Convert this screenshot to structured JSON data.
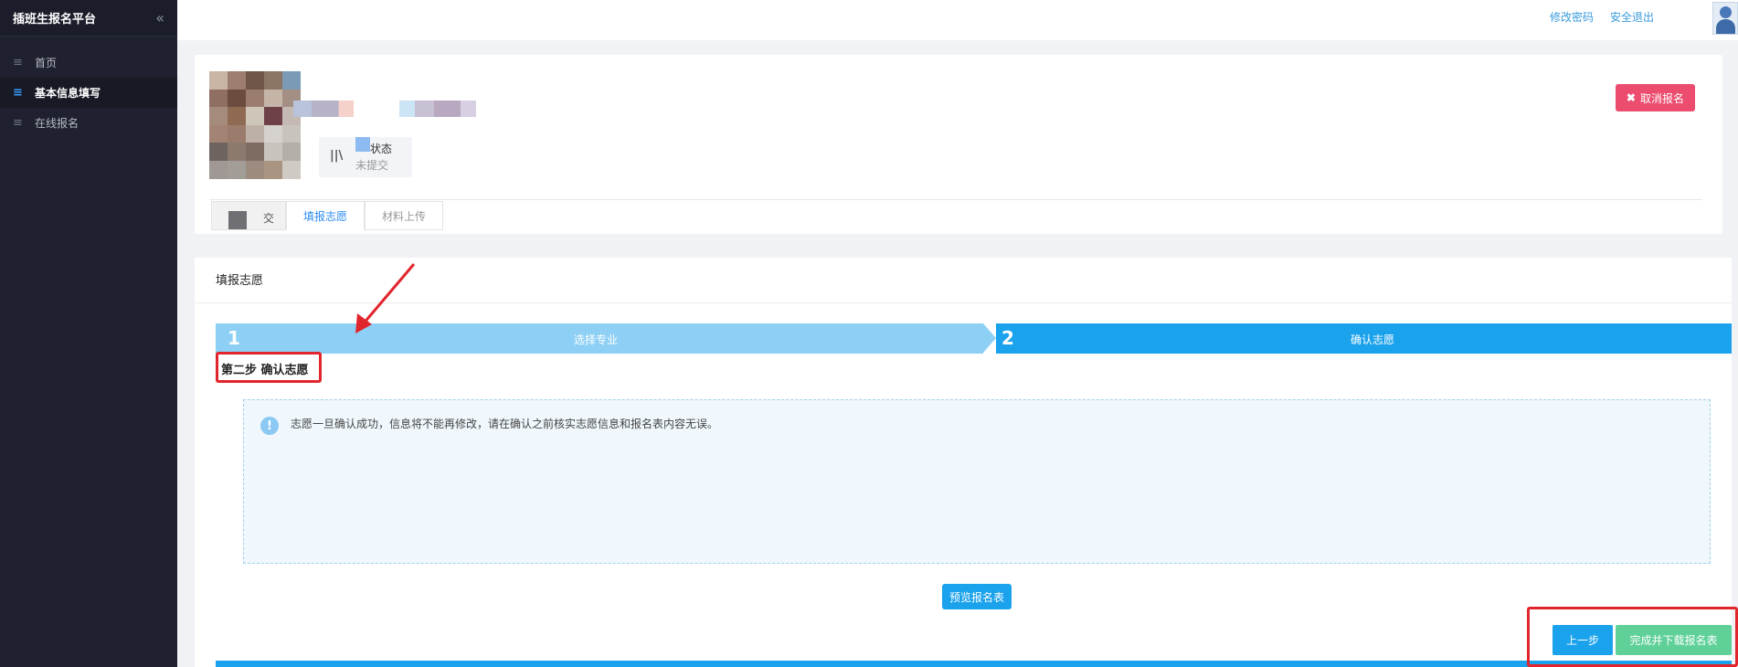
{
  "sidebar": {
    "brand_title": "插班生报名平台",
    "collapse_icon": "double-chevron-left-icon",
    "items": [
      {
        "label": "首页",
        "icon": "menu-lines-icon",
        "active": false
      },
      {
        "label": "基本信息填写",
        "icon": "menu-lines-icon",
        "active": true
      },
      {
        "label": "在线报名",
        "icon": "menu-lines-icon",
        "active": false
      }
    ]
  },
  "header": {
    "change_password": "修改密码",
    "logout": "安全退出",
    "avatar_icon": "user-avatar-icon"
  },
  "profile": {
    "status_label": "状态",
    "status_value": "未提交",
    "cancel_label": "取消报名",
    "tabs": [
      {
        "label": "交"
      },
      {
        "label": "填报志愿",
        "active": true
      },
      {
        "label": "材料上传"
      }
    ]
  },
  "main": {
    "title": "填报志愿",
    "steps": [
      {
        "num": "1",
        "label": "选择专业"
      },
      {
        "num": "2",
        "label": "确认志愿"
      }
    ],
    "sub_title": "第二步 确认志愿",
    "notice": "志愿一旦确认成功，信息将不能再修改，请在确认之前核实志愿信息和报名表内容无误。",
    "preview_label": "预览报名表",
    "prev_label": "上一步",
    "finish_label": "完成并下载报名表"
  },
  "colors": {
    "sidebar_bg": "#1f2130",
    "accent_blue": "#1aa2ec",
    "step_done": "#8ed0f5",
    "danger": "#ec4d6e",
    "success": "#5ed098",
    "annotation_red": "#e1252c"
  }
}
